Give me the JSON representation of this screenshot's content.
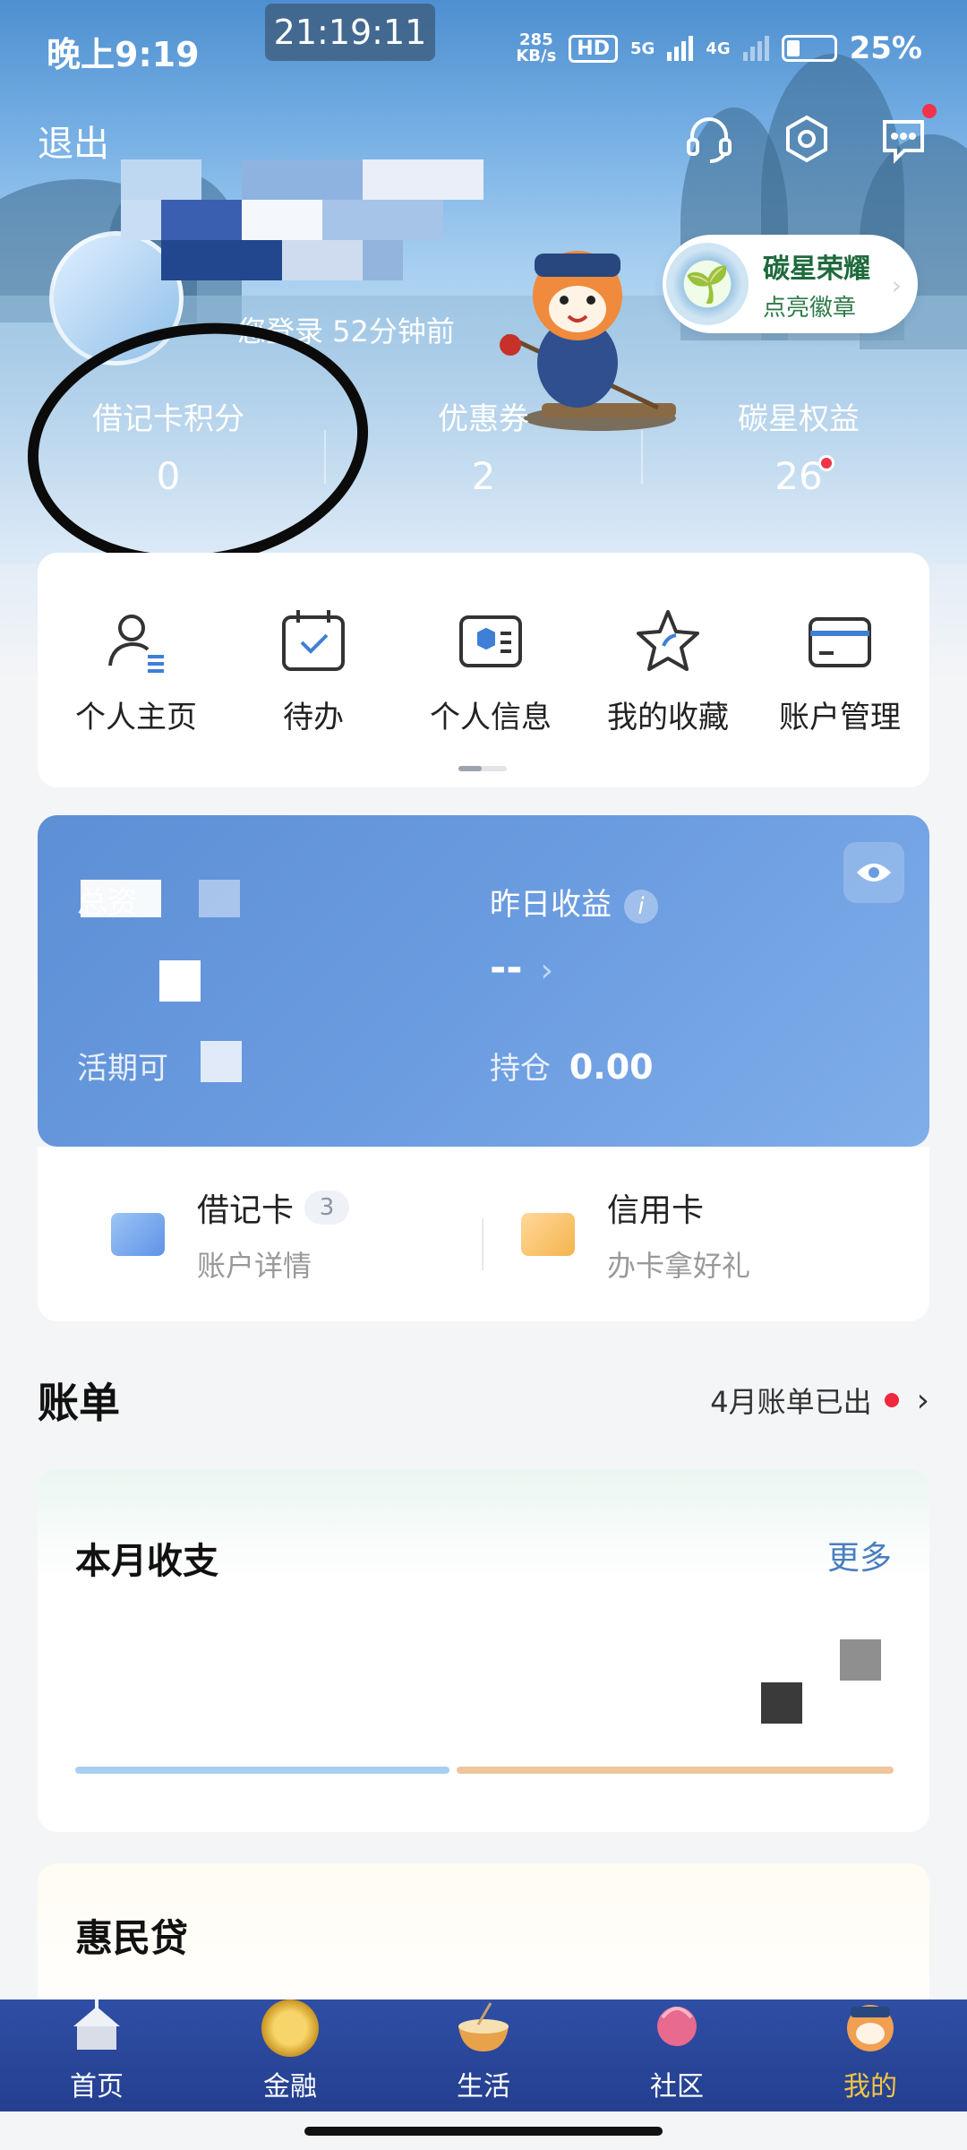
{
  "status": {
    "time": "晚上9:19",
    "clock": "21:19:11",
    "speed_top": "285",
    "speed_bottom": "KB/s",
    "hd": "HD",
    "net1": "5G",
    "net2": "4G",
    "battery": "25%"
  },
  "header": {
    "logout": "退出",
    "last_login": "您登录 52分钟前",
    "badge_title": "碳星荣耀",
    "badge_sub": "点亮徽章"
  },
  "stats": [
    {
      "label": "借记卡积分",
      "value": "0"
    },
    {
      "label": "优惠券",
      "value": "2"
    },
    {
      "label": "碳星权益",
      "value": "26"
    }
  ],
  "quick_menu": [
    {
      "label": "个人主页",
      "icon": "person-icon"
    },
    {
      "label": "待办",
      "icon": "calendar-check-icon"
    },
    {
      "label": "个人信息",
      "icon": "id-card-icon"
    },
    {
      "label": "我的收藏",
      "icon": "star-icon"
    },
    {
      "label": "账户管理",
      "icon": "card-icon"
    }
  ],
  "assets": {
    "total_label": "总资",
    "yesterday_label": "昨日收益",
    "yesterday_value": "--",
    "current_label": "活期可",
    "holding_label": "持仓",
    "holding_value": "0.00"
  },
  "cards": {
    "debit_title": "借记卡",
    "debit_count": "3",
    "debit_sub": "账户详情",
    "credit_title": "信用卡",
    "credit_sub": "办卡拿好礼"
  },
  "bills": {
    "title": "账单",
    "notice": "4月账单已出",
    "month_title": "本月收支",
    "more": "更多"
  },
  "loan": {
    "title": "惠民贷"
  },
  "tabs": [
    {
      "label": "首页"
    },
    {
      "label": "金融"
    },
    {
      "label": "生活"
    },
    {
      "label": "社区"
    },
    {
      "label": "我的"
    }
  ],
  "colors": {
    "accent": "#4a7ec0",
    "tabbar": "#2f4ea5",
    "active_tab": "#f5c542",
    "notice_dot": "#f0283d"
  }
}
